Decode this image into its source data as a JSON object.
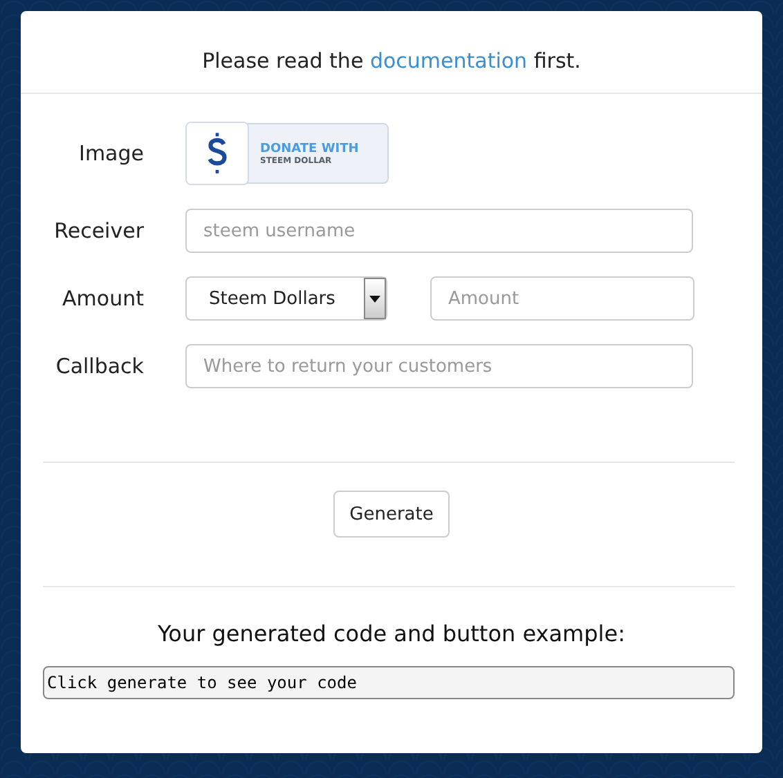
{
  "intro": {
    "before": "Please read the ",
    "link": "documentation",
    "after": " first."
  },
  "form": {
    "image_label": "Image",
    "badge": {
      "line1": "DONATE WITH",
      "line2": "STEEM DOLLAR"
    },
    "receiver": {
      "label": "Receiver",
      "placeholder": "steem username"
    },
    "amount": {
      "label": "Amount",
      "currency": "Steem Dollars",
      "placeholder": "Amount"
    },
    "callback": {
      "label": "Callback",
      "placeholder": "Where to return your customers"
    }
  },
  "generate_button": "Generate",
  "result": {
    "heading": "Your generated code and button example:",
    "code": "Click generate to see your code"
  }
}
